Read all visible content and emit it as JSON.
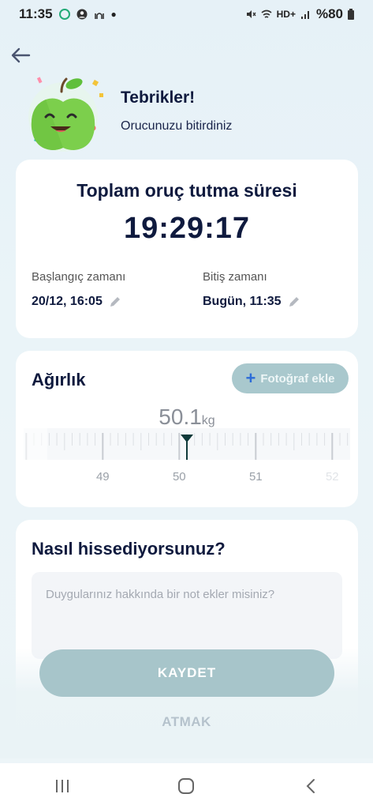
{
  "status_bar": {
    "time": "11:35",
    "battery": "%80",
    "network": "HD+"
  },
  "header": {
    "back_icon": "arrow-left-icon"
  },
  "hero": {
    "title": "Tebrikler!",
    "subtitle": "Orucunuzu bitirdiniz",
    "mascot": "smiling-apple"
  },
  "fasting_summary": {
    "title": "Toplam oruç tutma süresi",
    "duration": "19:29:17",
    "start_label": "Başlangıç zamanı",
    "start_value": "20/12, 16:05",
    "end_label": "Bitiş zamanı",
    "end_value": "Bugün, 11:35"
  },
  "weight": {
    "title": "Ağırlık",
    "add_photo_label": "Fotoğraf ekle",
    "value": "50.1",
    "unit": "kg",
    "ruler_labels": [
      "49",
      "50",
      "51",
      "52"
    ],
    "ruler_value": 50.1
  },
  "feeling": {
    "title": "Nasıl hissediyorsunuz?",
    "note_placeholder": "Duygularınız hakkında bir not ekler misiniz?"
  },
  "actions": {
    "save_label": "KAYDET",
    "discard_label": "ATMAK"
  },
  "colors": {
    "accent": "#2c6cd8",
    "button_disabled": "#a7c5ca",
    "title_text": "#0f1a3e"
  }
}
